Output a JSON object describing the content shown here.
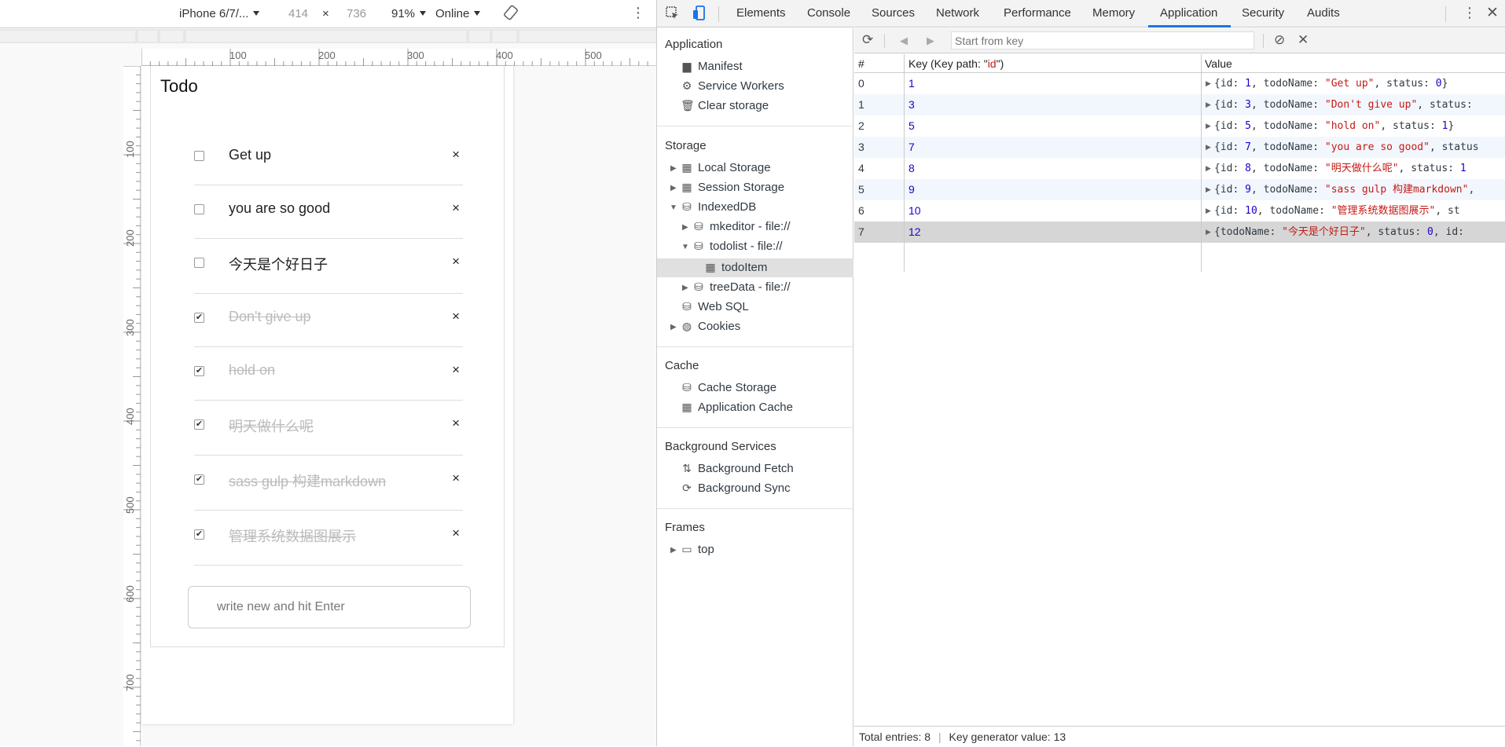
{
  "device_toolbar": {
    "device": "iPhone 6/7/...",
    "width": "414",
    "times": "×",
    "height": "736",
    "zoom": "91%",
    "network": "Online"
  },
  "rulers": {
    "h_labels": [
      "100",
      "200",
      "300",
      "400",
      "500"
    ],
    "v_labels": [
      "100",
      "200",
      "300",
      "400",
      "500",
      "600",
      "700"
    ]
  },
  "todo": {
    "title": "Todo",
    "items": [
      {
        "text": "Get up",
        "done": false
      },
      {
        "text": "you are so good",
        "done": false
      },
      {
        "text": "今天是个好日子",
        "done": false
      },
      {
        "text": "Don't give up",
        "done": true
      },
      {
        "text": "hold on",
        "done": true
      },
      {
        "text": "明天做什么呢",
        "done": true
      },
      {
        "text": "sass gulp 构建markdown",
        "done": true
      },
      {
        "text": "管理系统数据图展示",
        "done": true
      }
    ],
    "delete_glyph": "×",
    "input_placeholder": "write new and hit Enter"
  },
  "devtools": {
    "tabs": [
      "Elements",
      "Console",
      "Sources",
      "Network",
      "Performance",
      "Memory",
      "Application",
      "Security",
      "Audits"
    ],
    "active_tab": "Application",
    "accent_color": "#1a73e8"
  },
  "sidebar": {
    "application": {
      "title": "Application",
      "items": [
        "Manifest",
        "Service Workers",
        "Clear storage"
      ]
    },
    "storage": {
      "title": "Storage",
      "local_storage": "Local Storage",
      "session_storage": "Session Storage",
      "indexeddb": "IndexedDB",
      "mkeditor": "mkeditor - file://",
      "todolist": "todolist - file://",
      "todoitem": "todoItem",
      "treedata": "treeData - file://",
      "websql": "Web SQL",
      "cookies": "Cookies"
    },
    "cache": {
      "title": "Cache",
      "items": [
        "Cache Storage",
        "Application Cache"
      ]
    },
    "background": {
      "title": "Background Services",
      "items": [
        "Background Fetch",
        "Background Sync"
      ]
    },
    "frames": {
      "title": "Frames",
      "top": "top"
    }
  },
  "idb": {
    "filter_placeholder": "Start from key",
    "columns": {
      "index": "#",
      "key_prefix": "Key (Key path: \"",
      "key_path": "id",
      "key_suffix": "\")",
      "value": "Value"
    },
    "rows": [
      {
        "index": "0",
        "key": "1",
        "parts": [
          [
            "p",
            "{id: "
          ],
          [
            "n",
            "1"
          ],
          [
            "p",
            ", todoName: "
          ],
          [
            "s",
            "\"Get up\""
          ],
          [
            "p",
            ", status: "
          ],
          [
            "n",
            "0"
          ],
          [
            "p",
            "}"
          ]
        ]
      },
      {
        "index": "1",
        "key": "3",
        "parts": [
          [
            "p",
            "{id: "
          ],
          [
            "n",
            "3"
          ],
          [
            "p",
            ", todoName: "
          ],
          [
            "s",
            "\"Don't give up\""
          ],
          [
            "p",
            ", status: "
          ]
        ]
      },
      {
        "index": "2",
        "key": "5",
        "parts": [
          [
            "p",
            "{id: "
          ],
          [
            "n",
            "5"
          ],
          [
            "p",
            ", todoName: "
          ],
          [
            "s",
            "\"hold on\""
          ],
          [
            "p",
            ", status: "
          ],
          [
            "n",
            "1"
          ],
          [
            "p",
            "}"
          ]
        ]
      },
      {
        "index": "3",
        "key": "7",
        "parts": [
          [
            "p",
            "{id: "
          ],
          [
            "n",
            "7"
          ],
          [
            "p",
            ", todoName: "
          ],
          [
            "s",
            "\"you are so good\""
          ],
          [
            "p",
            ", status"
          ]
        ]
      },
      {
        "index": "4",
        "key": "8",
        "parts": [
          [
            "p",
            "{id: "
          ],
          [
            "n",
            "8"
          ],
          [
            "p",
            ", todoName: "
          ],
          [
            "s",
            "\"明天做什么呢\""
          ],
          [
            "p",
            ", status: "
          ],
          [
            "n",
            "1"
          ]
        ]
      },
      {
        "index": "5",
        "key": "9",
        "parts": [
          [
            "p",
            "{id: "
          ],
          [
            "n",
            "9"
          ],
          [
            "p",
            ", todoName: "
          ],
          [
            "s",
            "\"sass gulp 构建markdown\""
          ],
          [
            "p",
            ","
          ]
        ]
      },
      {
        "index": "6",
        "key": "10",
        "parts": [
          [
            "p",
            "{id: "
          ],
          [
            "n",
            "10"
          ],
          [
            "p",
            ", todoName: "
          ],
          [
            "s",
            "\"管理系统数据图展示\""
          ],
          [
            "p",
            ", st"
          ]
        ]
      },
      {
        "index": "7",
        "key": "12",
        "parts": [
          [
            "p",
            "{todoName: "
          ],
          [
            "s",
            "\"今天是个好日子\""
          ],
          [
            "p",
            ", status: "
          ],
          [
            "n",
            "0"
          ],
          [
            "p",
            ", id:"
          ]
        ]
      }
    ],
    "selected_row": 7,
    "footer": {
      "entries": "Total entries: 8",
      "sep": "|",
      "keygen": "Key generator value: 13"
    }
  }
}
